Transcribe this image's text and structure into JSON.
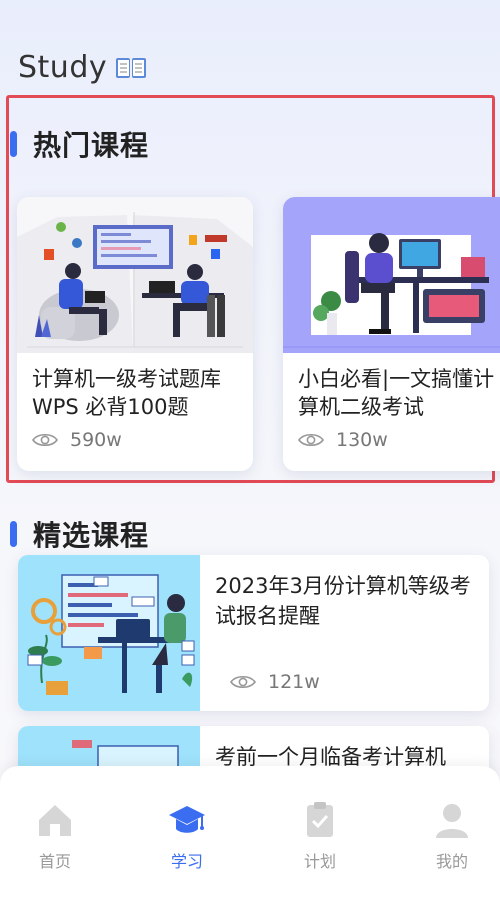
{
  "header": {
    "title": "Study",
    "icon": "book-icon"
  },
  "hot_section": {
    "title": "热门课程",
    "courses": [
      {
        "title": "计算机一级考试题库 WPS 必背100题",
        "views": "590w"
      },
      {
        "title": "小白必看|一文搞懂计算机二级考试",
        "views": "130w"
      }
    ]
  },
  "featured_section": {
    "title": "精选课程",
    "courses": [
      {
        "title": "2023年3月份计算机等级考试报名提醒",
        "views": "121w"
      },
      {
        "title": "考前一个月临备考计算机",
        "views": ""
      }
    ]
  },
  "tabbar": {
    "items": [
      {
        "label": "首页",
        "icon": "home-icon"
      },
      {
        "label": "学习",
        "icon": "graduation-cap-icon"
      },
      {
        "label": "计划",
        "icon": "clipboard-check-icon"
      },
      {
        "label": "我的",
        "icon": "user-icon"
      }
    ],
    "active_index": 1
  },
  "colors": {
    "accent": "#3a6df0",
    "highlight_border": "#e24a55",
    "inactive_tab": "#999999",
    "thumb_blue": "#9fe2fb",
    "thumb_purple": "#a4a4fb"
  }
}
